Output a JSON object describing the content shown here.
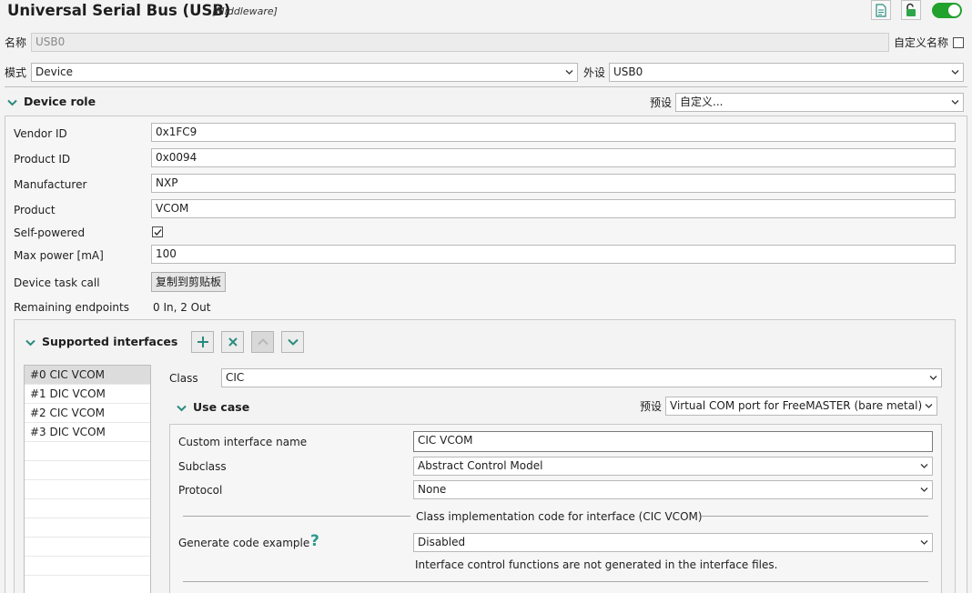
{
  "header": {
    "title": "Universal Serial Bus (USB)",
    "subtitle": "[Middleware]",
    "toggle_on": true,
    "icons": [
      "document-icon",
      "unlock-icon",
      "toggle-switch"
    ]
  },
  "colors": {
    "accent": "#22a12c",
    "chevron": "#2a8a7d",
    "help": "#2a9a8d"
  },
  "name_row": {
    "label": "名称",
    "value": "USB0",
    "custom_name_label": "自定义名称",
    "custom_name_checked": false
  },
  "mode_row": {
    "mode_label": "模式",
    "mode_value": "Device",
    "peripheral_label": "外设",
    "peripheral_value": "USB0"
  },
  "device_role": {
    "title": "Device role",
    "preset_label": "预设",
    "preset_value": "自定义...",
    "fields": {
      "vendor_id": {
        "label": "Vendor ID",
        "value": "0x1FC9"
      },
      "product_id": {
        "label": "Product ID",
        "value": "0x0094"
      },
      "manufacturer": {
        "label": "Manufacturer",
        "value": "NXP"
      },
      "product": {
        "label": "Product",
        "value": "VCOM"
      },
      "self_powered": {
        "label": "Self-powered",
        "checked": true
      },
      "max_power": {
        "label": "Max power [mA]",
        "value": "100"
      },
      "device_task_call": {
        "label": "Device task call",
        "button": "复制到剪贴板"
      },
      "remaining_endpoints": {
        "label": "Remaining endpoints",
        "value": "0 In, 2 Out"
      }
    }
  },
  "supported_interfaces": {
    "title": "Supported interfaces",
    "tools": [
      "add-icon",
      "remove-icon",
      "move-up-icon",
      "move-down-icon"
    ],
    "items": [
      "#0 CIC VCOM",
      "#1 DIC VCOM",
      "#2 CIC VCOM",
      "#3 DIC VCOM"
    ],
    "selected_index": 0,
    "class_label": "Class",
    "class_value": "CIC",
    "use_case": {
      "title": "Use case",
      "preset_label": "预设",
      "preset_value": "Virtual COM port for FreeMASTER (bare metal)",
      "custom_name": {
        "label": "Custom interface name",
        "value": "CIC VCOM"
      },
      "subclass": {
        "label": "Subclass",
        "value": "Abstract Control Model"
      },
      "protocol": {
        "label": "Protocol",
        "value": "None"
      },
      "impl_section_title": "Class implementation code for interface (CIC VCOM)",
      "generate_example": {
        "label": "Generate code example",
        "help": "?",
        "value": "Disabled"
      },
      "info_note": "Interface control functions are not generated in the interface files."
    }
  }
}
